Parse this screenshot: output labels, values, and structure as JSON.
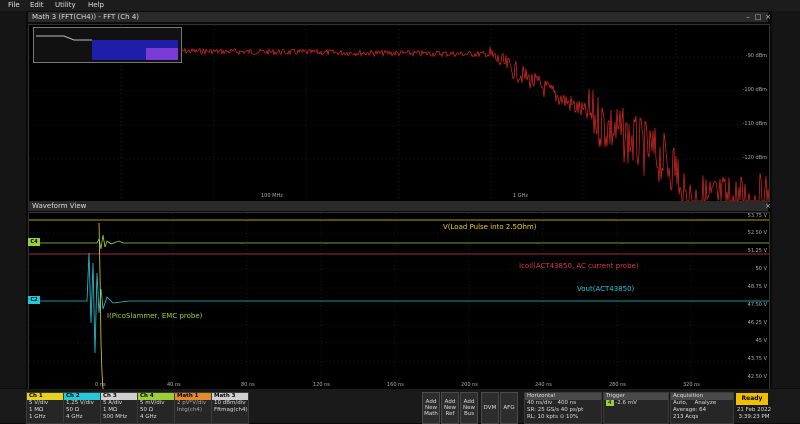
{
  "menu": {
    "items": [
      "File",
      "Edit",
      "Utility",
      "Help"
    ]
  },
  "fft_panel": {
    "title": "Math 3 (FFT(CH4)) - FFT (Ch 4)",
    "y_labels": [
      "-90 dBm",
      "-100 dBm",
      "-110 dBm",
      "-120 dBm"
    ],
    "x_labels": [
      "100 MHz",
      "1 GHz"
    ]
  },
  "wave_panel": {
    "title": "Waveform View",
    "y_labels": [
      "53.75 V",
      "52.50 V",
      "51.25 V",
      "50 V",
      "48.75 V",
      "47.50 V",
      "46.25 V",
      "45 V",
      "43.75 V",
      "42.50 V"
    ],
    "x_labels": [
      "0 ns",
      "40 ns",
      "80 ns",
      "120 ns",
      "160 ns",
      "200 ns",
      "240 ns",
      "280 ns",
      "320 ns"
    ],
    "labels": {
      "vload": "V(Load Pulse into 2.5Ohm)",
      "icoil": "Icoil(ACT43850, AC current probe)",
      "vout": "Vout(ACT43850)",
      "ipico": "I(PicoSlammer, EMC probe)"
    },
    "tags": {
      "c4": "C4",
      "c2": "C2"
    }
  },
  "channels": [
    {
      "name": "Ch 1",
      "l1": "5 V/div",
      "l2": "1 MΩ",
      "l3": "1 GHz",
      "color": "#e8d020"
    },
    {
      "name": "Ch 2",
      "l1": "1.25 V/div",
      "l2": "50 Ω",
      "l3": "4 GHz",
      "color": "#25c8d8"
    },
    {
      "name": "Ch 3",
      "l1": "5 A/div",
      "l2": "1 MΩ",
      "l3": "500 MHz",
      "color": "#cfcfcf"
    },
    {
      "name": "Ch 4",
      "l1": "5 mV/div",
      "l2": "50 Ω",
      "l3": "4 GHz",
      "color": "#9bcf3a"
    }
  ],
  "math": [
    {
      "name": "Math 1",
      "l1": "2 pV*V/div",
      "l2": "Intg(ch4)",
      "color": "#e58a2a"
    },
    {
      "name": "Math 3",
      "l1": "10 dBm/div",
      "l2": "Fftmag(ch4)",
      "color": "#cfcfcf"
    }
  ],
  "buttons": {
    "add_math": [
      "Add",
      "New",
      "Math"
    ],
    "add_ref": [
      "Add",
      "New",
      "Ref"
    ],
    "add_bus": [
      "Add",
      "New",
      "Bus"
    ],
    "dvm": "DVM",
    "afg": "AFG"
  },
  "horizontal": {
    "title": "Horizontal",
    "l1a": "40 ns/div",
    "l1b": "400 ns",
    "l2a": "SR: 25 GS/s",
    "l2b": "40 ps/pt",
    "l3a": "RL: 10 kpts",
    "l3b": "⊙ 10%"
  },
  "trigger": {
    "title": "Trigger",
    "l1": "-2.6 mV",
    "badge": "4"
  },
  "acquisition": {
    "title": "Acquisition",
    "l1a": "Auto,",
    "l1b": "Analyze",
    "l2": "Average: 64",
    "l3": "213 Acqs"
  },
  "status": {
    "ready": "Ready",
    "date": "21 Feb 2022",
    "time": "3:39:23 PM"
  },
  "colors": {
    "ch1": "#e8d020",
    "ch2": "#25c8d8",
    "ch4": "#9bcf3a",
    "math1": "#e58a2a",
    "fft": "#e02828",
    "icoil": "#d23a50"
  }
}
